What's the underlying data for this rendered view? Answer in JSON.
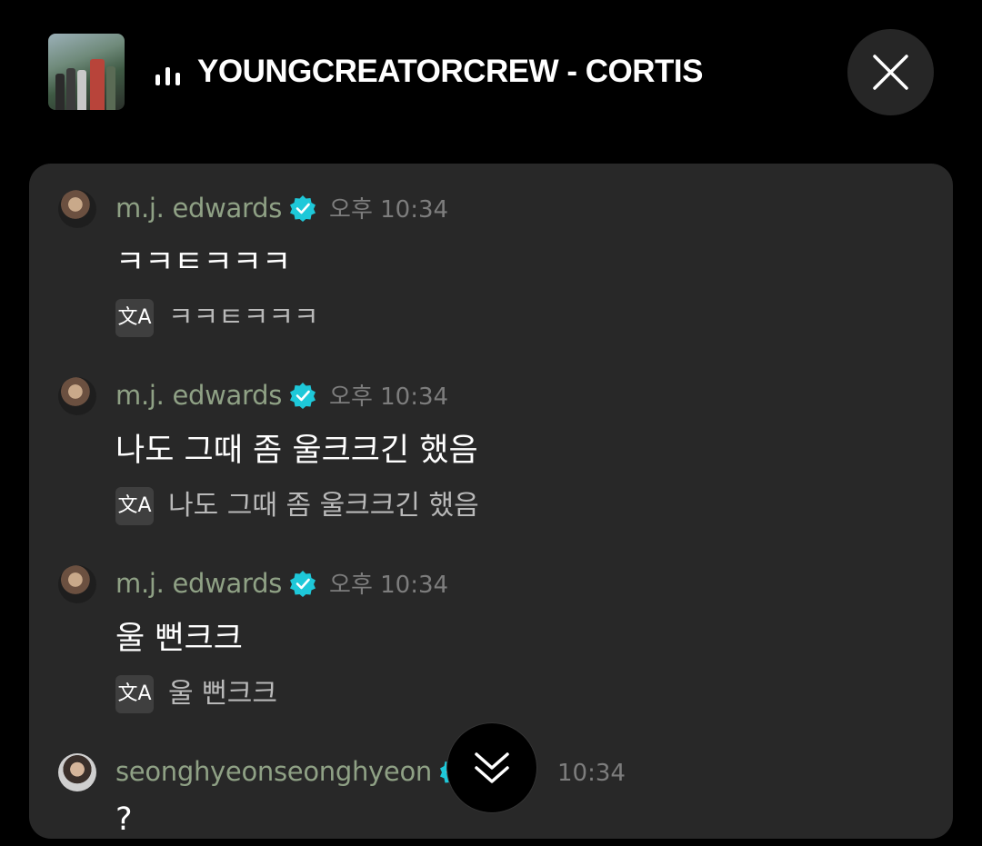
{
  "header": {
    "album_art": "album-cover-image",
    "now_playing_icon": "equalizer-icon",
    "song_title": "YOUNGCREATORCREW - CORTIS",
    "close_icon": "close-icon"
  },
  "messages": [
    {
      "username": "m.j. edwards",
      "verified": true,
      "time": "오후 10:34",
      "text": "ㅋㅋㅌㅋㅋㅋ",
      "translation_icon": "translate-icon",
      "translation": "ㅋㅋㅌㅋㅋㅋ"
    },
    {
      "username": "m.j. edwards",
      "verified": true,
      "time": "오후 10:34",
      "text": "나도 그때 좀 울크크긴 했음",
      "translation_icon": "translate-icon",
      "translation": "나도 그때 좀 울크크긴 했음"
    },
    {
      "username": "m.j. edwards",
      "verified": true,
      "time": "오후 10:34",
      "text": "울 뻔크크",
      "translation_icon": "translate-icon",
      "translation": "울 뻔크크"
    },
    {
      "username": "seonghyeonseonghyeon",
      "verified": true,
      "time": "10:34",
      "text": "?"
    }
  ],
  "scroll_button": {
    "icon": "double-chevron-down-icon"
  },
  "colors": {
    "background": "#000000",
    "panel": "#282828",
    "username": "#8fa185",
    "verified_badge": "#1ec8d9",
    "timestamp": "#7d7d7d",
    "translation_text": "#b9b9b9"
  }
}
